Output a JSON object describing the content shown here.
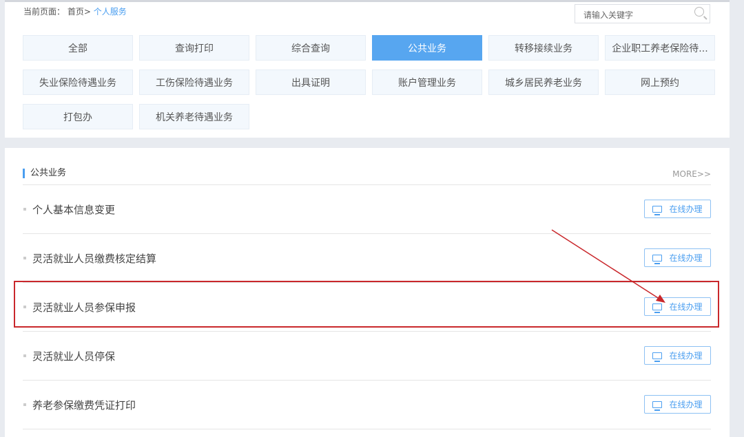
{
  "breadcrumb": {
    "prefix": "当前页面：",
    "home": "首页>",
    "current": "个人服务"
  },
  "search": {
    "placeholder": "请输入关键字"
  },
  "categories": [
    "全部",
    "查询打印",
    "综合查询",
    "公共业务",
    "转移接续业务",
    "企业职工养老保险待...",
    "失业保险待遇业务",
    "工伤保险待遇业务",
    "出具证明",
    "账户管理业务",
    "城乡居民养老业务",
    "网上预约",
    "打包办",
    "机关养老待遇业务"
  ],
  "active_category": "公共业务",
  "section": {
    "title": "公共业务",
    "more": "MORE>>",
    "button_label": "在线办理",
    "items": [
      "个人基本信息变更",
      "灵活就业人员缴费核定结算",
      "灵活就业人员参保申报",
      "灵活就业人员停保",
      "养老参保缴费凭证打印"
    ]
  },
  "annotation_color": "#c9272b"
}
